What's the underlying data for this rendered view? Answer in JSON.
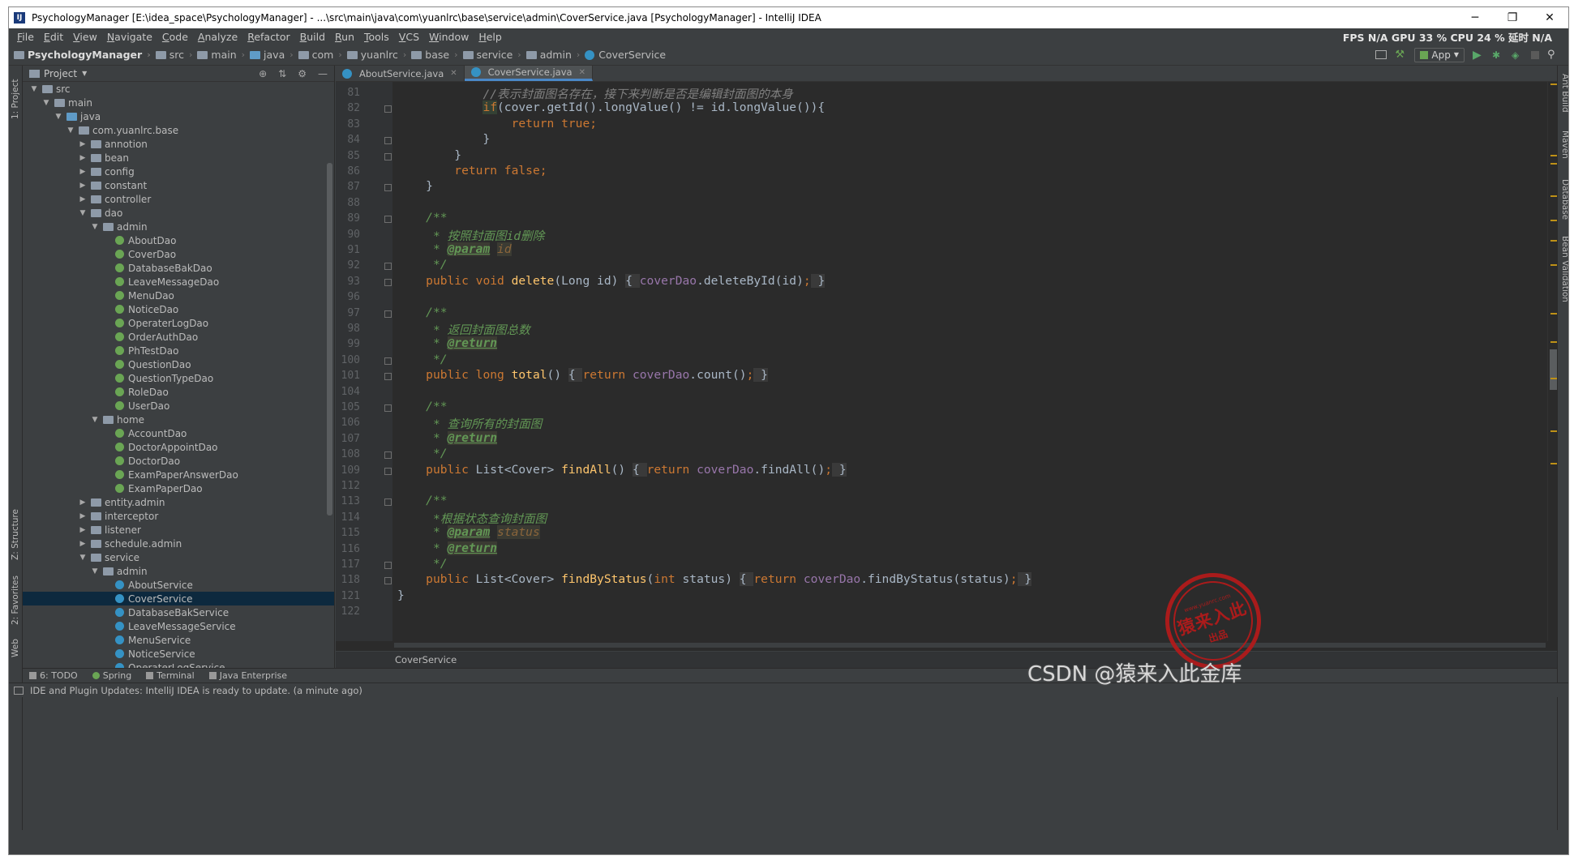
{
  "window": {
    "title": "PsychologyManager [E:\\idea_space\\PsychologyManager] - ...\\src\\main\\java\\com\\yuanlrc\\base\\service\\admin\\CoverService.java [PsychologyManager] - IntelliJ IDEA",
    "minimize": "─",
    "restore": "❐",
    "close": "✕"
  },
  "menu": {
    "items": [
      "File",
      "Edit",
      "View",
      "Navigate",
      "Code",
      "Analyze",
      "Refactor",
      "Build",
      "Run",
      "Tools",
      "VCS",
      "Window",
      "Help"
    ],
    "stats": "FPS  N/A  GPU  33 %  CPU  24 %  延时  N/A"
  },
  "navbar": {
    "crumbs": [
      "PsychologyManager",
      "src",
      "main",
      "java",
      "com",
      "yuanlrc",
      "base",
      "service",
      "admin",
      "CoverService"
    ],
    "run_config": "App"
  },
  "left_tabs": [
    "1: Project",
    "Z: Structure",
    "2: Favorites",
    "Web"
  ],
  "right_tabs": [
    "Ant Build",
    "Maven",
    "Database",
    "Bean Validation"
  ],
  "project": {
    "title": "Project",
    "tree": [
      {
        "label": "src",
        "depth": 1,
        "arrow": "▼",
        "icon": "folder"
      },
      {
        "label": "main",
        "depth": 2,
        "arrow": "▼",
        "icon": "folder"
      },
      {
        "label": "java",
        "depth": 3,
        "arrow": "▼",
        "icon": "src-folder"
      },
      {
        "label": "com.yuanlrc.base",
        "depth": 4,
        "arrow": "▼",
        "icon": "folder"
      },
      {
        "label": "annotion",
        "depth": 5,
        "arrow": "▶",
        "icon": "folder"
      },
      {
        "label": "bean",
        "depth": 5,
        "arrow": "▶",
        "icon": "folder"
      },
      {
        "label": "config",
        "depth": 5,
        "arrow": "▶",
        "icon": "folder"
      },
      {
        "label": "constant",
        "depth": 5,
        "arrow": "▶",
        "icon": "folder"
      },
      {
        "label": "controller",
        "depth": 5,
        "arrow": "▶",
        "icon": "folder"
      },
      {
        "label": "dao",
        "depth": 5,
        "arrow": "▼",
        "icon": "folder"
      },
      {
        "label": "admin",
        "depth": 6,
        "arrow": "▼",
        "icon": "folder"
      },
      {
        "label": "AboutDao",
        "depth": 7,
        "arrow": "",
        "icon": "interface"
      },
      {
        "label": "CoverDao",
        "depth": 7,
        "arrow": "",
        "icon": "interface"
      },
      {
        "label": "DatabaseBakDao",
        "depth": 7,
        "arrow": "",
        "icon": "interface"
      },
      {
        "label": "LeaveMessageDao",
        "depth": 7,
        "arrow": "",
        "icon": "interface"
      },
      {
        "label": "MenuDao",
        "depth": 7,
        "arrow": "",
        "icon": "interface"
      },
      {
        "label": "NoticeDao",
        "depth": 7,
        "arrow": "",
        "icon": "interface"
      },
      {
        "label": "OperaterLogDao",
        "depth": 7,
        "arrow": "",
        "icon": "interface"
      },
      {
        "label": "OrderAuthDao",
        "depth": 7,
        "arrow": "",
        "icon": "interface"
      },
      {
        "label": "PhTestDao",
        "depth": 7,
        "arrow": "",
        "icon": "interface"
      },
      {
        "label": "QuestionDao",
        "depth": 7,
        "arrow": "",
        "icon": "interface"
      },
      {
        "label": "QuestionTypeDao",
        "depth": 7,
        "arrow": "",
        "icon": "interface"
      },
      {
        "label": "RoleDao",
        "depth": 7,
        "arrow": "",
        "icon": "interface"
      },
      {
        "label": "UserDao",
        "depth": 7,
        "arrow": "",
        "icon": "interface"
      },
      {
        "label": "home",
        "depth": 6,
        "arrow": "▼",
        "icon": "folder"
      },
      {
        "label": "AccountDao",
        "depth": 7,
        "arrow": "",
        "icon": "interface"
      },
      {
        "label": "DoctorAppointDao",
        "depth": 7,
        "arrow": "",
        "icon": "interface"
      },
      {
        "label": "DoctorDao",
        "depth": 7,
        "arrow": "",
        "icon": "interface"
      },
      {
        "label": "ExamPaperAnswerDao",
        "depth": 7,
        "arrow": "",
        "icon": "interface"
      },
      {
        "label": "ExamPaperDao",
        "depth": 7,
        "arrow": "",
        "icon": "interface"
      },
      {
        "label": "entity.admin",
        "depth": 5,
        "arrow": "▶",
        "icon": "folder"
      },
      {
        "label": "interceptor",
        "depth": 5,
        "arrow": "▶",
        "icon": "folder"
      },
      {
        "label": "listener",
        "depth": 5,
        "arrow": "▶",
        "icon": "folder"
      },
      {
        "label": "schedule.admin",
        "depth": 5,
        "arrow": "▶",
        "icon": "folder"
      },
      {
        "label": "service",
        "depth": 5,
        "arrow": "▼",
        "icon": "folder"
      },
      {
        "label": "admin",
        "depth": 6,
        "arrow": "▼",
        "icon": "folder"
      },
      {
        "label": "AboutService",
        "depth": 7,
        "arrow": "",
        "icon": "class"
      },
      {
        "label": "CoverService",
        "depth": 7,
        "arrow": "",
        "icon": "class",
        "selected": true
      },
      {
        "label": "DatabaseBakService",
        "depth": 7,
        "arrow": "",
        "icon": "class"
      },
      {
        "label": "LeaveMessageService",
        "depth": 7,
        "arrow": "",
        "icon": "class"
      },
      {
        "label": "MenuService",
        "depth": 7,
        "arrow": "",
        "icon": "class"
      },
      {
        "label": "NoticeService",
        "depth": 7,
        "arrow": "",
        "icon": "class"
      },
      {
        "label": "OperaterLogService",
        "depth": 7,
        "arrow": "",
        "icon": "class"
      }
    ]
  },
  "editor": {
    "tabs": [
      {
        "label": "AboutService.java",
        "active": false
      },
      {
        "label": "CoverService.java",
        "active": true
      }
    ],
    "lines": [
      {
        "n": "81",
        "fold": false,
        "tokens": [
          {
            "t": "            "
          },
          {
            "t": "//表示封面图名存在，接下来判断是否是编辑封面图的本身",
            "c": "cm"
          }
        ]
      },
      {
        "n": "82",
        "fold": true,
        "tokens": [
          {
            "t": "            "
          },
          {
            "t": "if",
            "c": "kw ifhl"
          },
          {
            "t": "(cover.getId().longValue() != id.longValue()){"
          }
        ]
      },
      {
        "n": "83",
        "fold": false,
        "tokens": [
          {
            "t": "                "
          },
          {
            "t": "return true",
            "c": "kw"
          },
          {
            "t": ";",
            "c": "kw"
          }
        ]
      },
      {
        "n": "84",
        "fold": true,
        "tokens": [
          {
            "t": "            }"
          }
        ]
      },
      {
        "n": "85",
        "fold": true,
        "tokens": [
          {
            "t": "        }"
          }
        ]
      },
      {
        "n": "86",
        "fold": false,
        "tokens": [
          {
            "t": "        "
          },
          {
            "t": "return false",
            "c": "kw"
          },
          {
            "t": ";",
            "c": "kw"
          }
        ]
      },
      {
        "n": "87",
        "fold": true,
        "tokens": [
          {
            "t": "    }"
          }
        ]
      },
      {
        "n": "88",
        "fold": false,
        "tokens": [
          {
            "t": ""
          }
        ]
      },
      {
        "n": "89",
        "fold": true,
        "tokens": [
          {
            "t": "    "
          },
          {
            "t": "/**",
            "c": "jd"
          }
        ]
      },
      {
        "n": "90",
        "fold": false,
        "tokens": [
          {
            "t": "     "
          },
          {
            "t": "* 按照封面图id删除",
            "c": "jd"
          }
        ]
      },
      {
        "n": "91",
        "fold": false,
        "tokens": [
          {
            "t": "     "
          },
          {
            "t": "* ",
            "c": "jd"
          },
          {
            "t": "@param",
            "c": "tag"
          },
          {
            "t": " "
          },
          {
            "t": "id",
            "c": "pv"
          }
        ]
      },
      {
        "n": "92",
        "fold": true,
        "tokens": [
          {
            "t": "     "
          },
          {
            "t": "*/",
            "c": "jd"
          }
        ]
      },
      {
        "n": "93",
        "fold": true,
        "tokens": [
          {
            "t": "    "
          },
          {
            "t": "public void ",
            "c": "kw"
          },
          {
            "t": "delete",
            "c": "fn"
          },
          {
            "t": "(Long id) "
          },
          {
            "t": "{ ",
            "c": "fold-bg"
          },
          {
            "t": "coverDao",
            "c": "fd"
          },
          {
            "t": ".deleteById(id)"
          },
          {
            "t": ";",
            "c": "kw"
          },
          {
            "t": " }",
            "c": "fold-bg"
          }
        ]
      },
      {
        "n": "96",
        "fold": false,
        "tokens": [
          {
            "t": ""
          }
        ]
      },
      {
        "n": "97",
        "fold": true,
        "tokens": [
          {
            "t": "    "
          },
          {
            "t": "/**",
            "c": "jd"
          }
        ]
      },
      {
        "n": "98",
        "fold": false,
        "tokens": [
          {
            "t": "     "
          },
          {
            "t": "* 返回封面图总数",
            "c": "jd"
          }
        ]
      },
      {
        "n": "99",
        "fold": false,
        "tokens": [
          {
            "t": "     "
          },
          {
            "t": "* ",
            "c": "jd"
          },
          {
            "t": "@return",
            "c": "tag"
          }
        ]
      },
      {
        "n": "100",
        "fold": true,
        "tokens": [
          {
            "t": "     "
          },
          {
            "t": "*/",
            "c": "jd"
          }
        ]
      },
      {
        "n": "101",
        "fold": true,
        "tokens": [
          {
            "t": "    "
          },
          {
            "t": "public long ",
            "c": "kw"
          },
          {
            "t": "total",
            "c": "fn"
          },
          {
            "t": "() "
          },
          {
            "t": "{ ",
            "c": "fold-bg"
          },
          {
            "t": "return ",
            "c": "kw"
          },
          {
            "t": "coverDao",
            "c": "fd"
          },
          {
            "t": ".count()"
          },
          {
            "t": ";",
            "c": "kw"
          },
          {
            "t": " }",
            "c": "fold-bg"
          }
        ]
      },
      {
        "n": "104",
        "fold": false,
        "tokens": [
          {
            "t": ""
          }
        ]
      },
      {
        "n": "105",
        "fold": true,
        "tokens": [
          {
            "t": "    "
          },
          {
            "t": "/**",
            "c": "jd"
          }
        ]
      },
      {
        "n": "106",
        "fold": false,
        "tokens": [
          {
            "t": "     "
          },
          {
            "t": "* 查询所有的封面图",
            "c": "jd"
          }
        ]
      },
      {
        "n": "107",
        "fold": false,
        "tokens": [
          {
            "t": "     "
          },
          {
            "t": "* ",
            "c": "jd"
          },
          {
            "t": "@return",
            "c": "tag"
          }
        ]
      },
      {
        "n": "108",
        "fold": true,
        "tokens": [
          {
            "t": "     "
          },
          {
            "t": "*/",
            "c": "jd"
          }
        ]
      },
      {
        "n": "109",
        "fold": true,
        "tokens": [
          {
            "t": "    "
          },
          {
            "t": "public ",
            "c": "kw"
          },
          {
            "t": "List<Cover> "
          },
          {
            "t": "findAll",
            "c": "fn"
          },
          {
            "t": "() "
          },
          {
            "t": "{ ",
            "c": "fold-bg"
          },
          {
            "t": "return ",
            "c": "kw"
          },
          {
            "t": "coverDao",
            "c": "fd"
          },
          {
            "t": ".findAll()"
          },
          {
            "t": ";",
            "c": "kw"
          },
          {
            "t": " }",
            "c": "fold-bg"
          }
        ]
      },
      {
        "n": "112",
        "fold": false,
        "tokens": [
          {
            "t": ""
          }
        ]
      },
      {
        "n": "113",
        "fold": true,
        "tokens": [
          {
            "t": "    "
          },
          {
            "t": "/**",
            "c": "jd"
          }
        ]
      },
      {
        "n": "114",
        "fold": false,
        "tokens": [
          {
            "t": "     "
          },
          {
            "t": "*根据状态查询封面图",
            "c": "jd"
          }
        ]
      },
      {
        "n": "115",
        "fold": false,
        "tokens": [
          {
            "t": "     "
          },
          {
            "t": "* ",
            "c": "jd"
          },
          {
            "t": "@param",
            "c": "tag"
          },
          {
            "t": " "
          },
          {
            "t": "status",
            "c": "pv"
          }
        ]
      },
      {
        "n": "116",
        "fold": false,
        "tokens": [
          {
            "t": "     "
          },
          {
            "t": "* ",
            "c": "jd"
          },
          {
            "t": "@return",
            "c": "tag"
          }
        ]
      },
      {
        "n": "117",
        "fold": true,
        "tokens": [
          {
            "t": "     "
          },
          {
            "t": "*/",
            "c": "jd"
          }
        ]
      },
      {
        "n": "118",
        "fold": true,
        "tokens": [
          {
            "t": "    "
          },
          {
            "t": "public ",
            "c": "kw"
          },
          {
            "t": "List<Cover> "
          },
          {
            "t": "findByStatus",
            "c": "fn"
          },
          {
            "t": "("
          },
          {
            "t": "int ",
            "c": "kw"
          },
          {
            "t": "status) "
          },
          {
            "t": "{ ",
            "c": "fold-bg"
          },
          {
            "t": "return ",
            "c": "kw"
          },
          {
            "t": "coverDao",
            "c": "fd"
          },
          {
            "t": ".findByStatus(status)"
          },
          {
            "t": ";",
            "c": "kw"
          },
          {
            "t": " }",
            "c": "fold-bg"
          }
        ]
      },
      {
        "n": "121",
        "fold": false,
        "tokens": [
          {
            "t": "}"
          }
        ]
      },
      {
        "n": "122",
        "fold": false,
        "tokens": [
          {
            "t": ""
          }
        ]
      }
    ],
    "breadcrumb": "CoverService"
  },
  "bottom_tools": [
    {
      "label": "6: TODO"
    },
    {
      "label": "Spring"
    },
    {
      "label": "Terminal"
    },
    {
      "label": "Java Enterprise"
    }
  ],
  "status": {
    "message": "IDE and Plugin Updates: IntelliJ IDEA is ready to update. (a minute ago)"
  },
  "watermark": {
    "seal_url": "www.yuanrc.com",
    "seal_main": "猿来入此",
    "seal_sub": "出品",
    "csdn": "CSDN @猿来入此金库"
  },
  "colors": {
    "background": "#2b2b2b",
    "panel": "#3c3f41",
    "keyword": "#cc7832",
    "method": "#ffc66d",
    "field": "#9876aa",
    "doc": "#629755",
    "selection": "#0d293e"
  }
}
